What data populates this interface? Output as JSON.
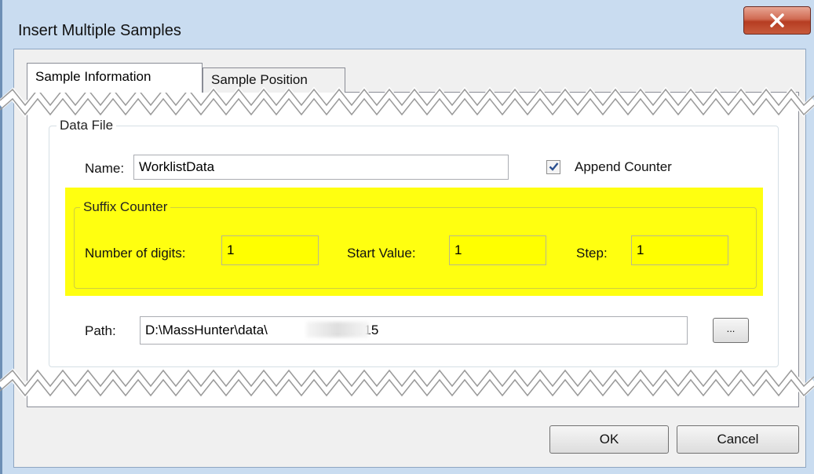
{
  "window": {
    "title": "Insert Multiple Samples",
    "close_label": "x"
  },
  "tabs": [
    {
      "label": "Sample Information",
      "selected": true
    },
    {
      "label": "Sample Position",
      "selected": false
    }
  ],
  "data_file": {
    "group_label": "Data File",
    "name_label": "Name:",
    "name_value": "WorklistData",
    "append_counter_label": "Append Counter",
    "append_counter_checked": true,
    "suffix_counter": {
      "group_label": "Suffix Counter",
      "highlight_color": "#ffff10",
      "digits_label": "Number of digits:",
      "digits_value": "1",
      "start_label": "Start Value:",
      "start_value": "1",
      "step_label": "Step:",
      "step_value": "1"
    },
    "path_label": "Path:",
    "path_prefix": "D:\\MassHunter\\data\\",
    "path_suffix": "\\160615",
    "browse_label": "..."
  },
  "buttons": {
    "ok": "OK",
    "cancel": "Cancel"
  }
}
